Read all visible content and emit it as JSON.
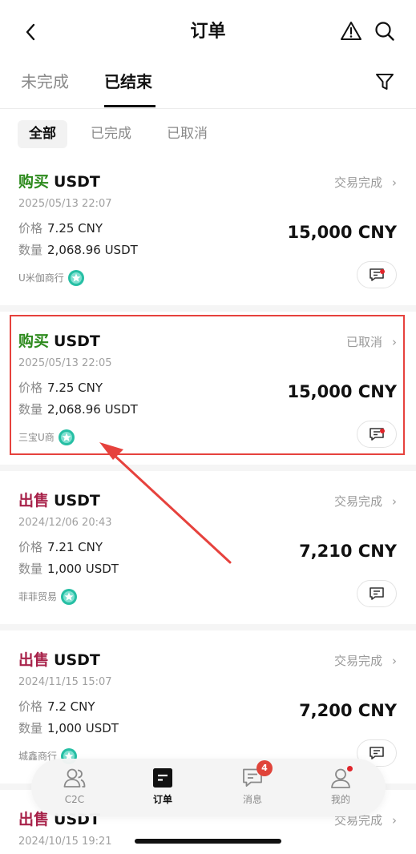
{
  "header": {
    "title": "订单"
  },
  "tabs": [
    {
      "label": "未完成"
    },
    {
      "label": "已结束"
    }
  ],
  "subtabs": [
    {
      "label": "全部"
    },
    {
      "label": "已完成"
    },
    {
      "label": "已取消"
    }
  ],
  "orders": [
    {
      "side": "购买",
      "asset": "USDT",
      "status": "交易完成",
      "time": "2025/05/13 22:07",
      "price_label": "价格",
      "price": "7.25 CNY",
      "qty_label": "数量",
      "qty": "2,068.96 USDT",
      "amount": "15,000 CNY",
      "merchant": "U米伽商行"
    },
    {
      "side": "购买",
      "asset": "USDT",
      "status": "已取消",
      "time": "2025/05/13 22:05",
      "price_label": "价格",
      "price": "7.25 CNY",
      "qty_label": "数量",
      "qty": "2,068.96 USDT",
      "amount": "15,000 CNY",
      "merchant": "三宝U商"
    },
    {
      "side": "出售",
      "asset": "USDT",
      "status": "交易完成",
      "time": "2024/12/06 20:43",
      "price_label": "价格",
      "price": "7.21 CNY",
      "qty_label": "数量",
      "qty": "1,000 USDT",
      "amount": "7,210 CNY",
      "merchant": "菲菲贸易"
    },
    {
      "side": "出售",
      "asset": "USDT",
      "status": "交易完成",
      "time": "2024/11/15 15:07",
      "price_label": "价格",
      "price": "7.2 CNY",
      "qty_label": "数量",
      "qty": "1,000 USDT",
      "amount": "7,200 CNY",
      "merchant": "城鑫商行"
    },
    {
      "side": "出售",
      "asset": "USDT",
      "status": "交易完成",
      "time": "2024/10/15 19:21"
    }
  ],
  "bottom_nav": [
    {
      "label": "C2C",
      "icon": "users-icon"
    },
    {
      "label": "订单",
      "icon": "orders-icon"
    },
    {
      "label": "消息",
      "icon": "message-icon",
      "badge": "4"
    },
    {
      "label": "我的",
      "icon": "profile-icon"
    }
  ],
  "colors": {
    "buy": "#2e8b1e",
    "sell": "#a8224a",
    "highlight": "#e6423d",
    "badge": "#e0443a"
  }
}
